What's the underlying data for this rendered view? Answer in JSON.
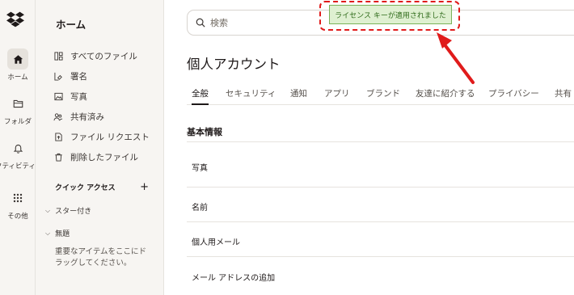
{
  "rail": {
    "items": [
      {
        "label": "ホーム",
        "icon": "home-icon",
        "active": true
      },
      {
        "label": "フォルダ",
        "icon": "folder-icon"
      },
      {
        "label": "アクティビティ",
        "icon": "bell-icon"
      },
      {
        "label": "その他",
        "icon": "grid-icon"
      }
    ]
  },
  "sidebar": {
    "title": "ホーム",
    "items": [
      {
        "label": "すべてのファイル",
        "icon": "files-icon"
      },
      {
        "label": "署名",
        "icon": "signature-icon"
      },
      {
        "label": "写真",
        "icon": "photo-icon"
      },
      {
        "label": "共有済み",
        "icon": "shared-icon"
      },
      {
        "label": "ファイル リクエスト",
        "icon": "file-request-icon"
      },
      {
        "label": "削除したファイル",
        "icon": "trash-icon"
      }
    ],
    "quick_access": {
      "label": "クイック アクセス",
      "add": "+"
    },
    "groups": [
      {
        "label": "スター付き"
      },
      {
        "label": "無題"
      }
    ],
    "empty_hint": "重要なアイテムをここにドラッグしてください。"
  },
  "search": {
    "placeholder": "検索"
  },
  "page": {
    "title": "個人アカウント",
    "tabs": [
      "全般",
      "セキュリティ",
      "通知",
      "アプリ",
      "ブランド",
      "友達に紹介する",
      "プライバシー",
      "共有"
    ],
    "active_tab": "全般",
    "section_title": "基本情報",
    "rows": [
      "写真",
      "名前",
      "個人用メール",
      "メール アドレスの追加"
    ]
  },
  "notice": {
    "text": "ライセンス キーが適用されました"
  },
  "colors": {
    "accent": "#e01b1b",
    "notice_bg": "#dff0d1",
    "notice_text": "#2f6b1a",
    "rail_bg": "#f7f5f2"
  }
}
